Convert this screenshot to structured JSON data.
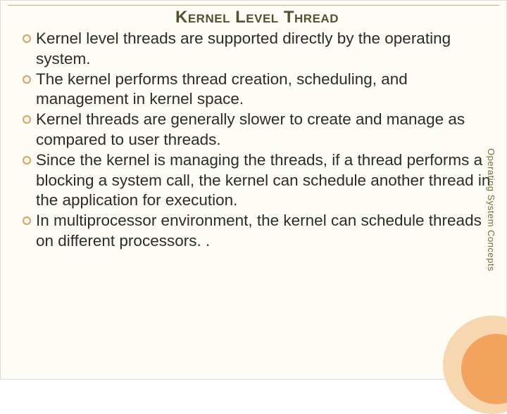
{
  "title": "Kernel Level Thread",
  "bullets": [
    "Kernel level threads are supported directly by the operating system.",
    "The kernel performs thread creation, scheduling, and management in kernel space.",
    "Kernel threads are generally slower to create and manage as compared to user threads.",
    "Since the kernel is managing the threads, if a thread performs a blocking a system call, the kernel can schedule another thread in the application for execution.",
    "In multiprocessor environment, the kernel can schedule threads on different processors. ."
  ],
  "side_label": "Operating System Concepts"
}
